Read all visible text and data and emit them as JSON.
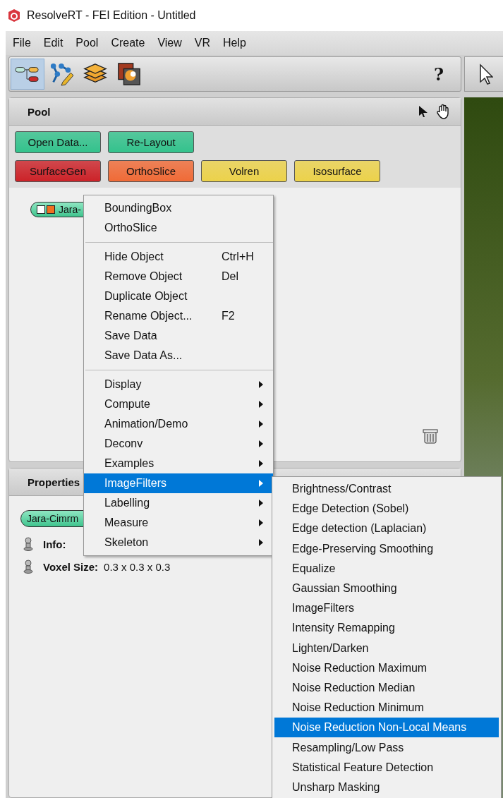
{
  "window": {
    "title": "ResolveRT - FEI Edition - Untitled"
  },
  "menubar": [
    "File",
    "Edit",
    "Pool",
    "Create",
    "View",
    "VR",
    "Help"
  ],
  "toolbar": {
    "tools": [
      {
        "kind": "pool",
        "selected": true
      },
      {
        "kind": "tree",
        "selected": false
      },
      {
        "kind": "layers",
        "selected": false
      },
      {
        "kind": "slices",
        "selected": false
      }
    ],
    "help": "?"
  },
  "pool": {
    "title": "Pool",
    "button_rows": [
      [
        {
          "label": "Open Data...",
          "color": "#33c28c"
        },
        {
          "label": "Re-Layout",
          "color": "#33c28c"
        }
      ],
      [
        {
          "label": "SurfaceGen",
          "color": "#cc2228"
        },
        {
          "label": "OrthoSlice",
          "color": "#f06a36"
        },
        {
          "label": "Volren",
          "color": "#ecd24a"
        },
        {
          "label": "Isosurface",
          "color": "#ecd24a"
        }
      ]
    ],
    "node": {
      "label": "Jara-"
    }
  },
  "properties": {
    "title": "Properties",
    "node": {
      "label": "Jara-Cimrm"
    },
    "fields": [
      {
        "label": "Info:"
      },
      {
        "label": "Voxel Size:",
        "value": "0.3 x 0.3 x 0.3"
      }
    ]
  },
  "context_menu": {
    "sections": [
      [
        {
          "label": "BoundingBox",
          "submenu": false,
          "selected": false
        },
        {
          "label": "OrthoSlice",
          "submenu": false,
          "selected": false
        }
      ],
      [
        {
          "label": "Hide Object",
          "shortcut": "Ctrl+H",
          "submenu": false,
          "selected": false
        },
        {
          "label": "Remove Object",
          "shortcut": "Del",
          "submenu": false,
          "selected": false
        },
        {
          "label": "Duplicate Object",
          "submenu": false,
          "selected": false
        },
        {
          "label": "Rename Object...",
          "shortcut": "F2",
          "submenu": false,
          "selected": false
        },
        {
          "label": "Save Data",
          "submenu": false,
          "selected": false
        },
        {
          "label": "Save Data As...",
          "submenu": false,
          "selected": false
        }
      ],
      [
        {
          "label": "Display",
          "submenu": true,
          "selected": false
        },
        {
          "label": "Compute",
          "submenu": true,
          "selected": false
        },
        {
          "label": "Animation/Demo",
          "submenu": true,
          "selected": false
        },
        {
          "label": "Deconv",
          "submenu": true,
          "selected": false
        },
        {
          "label": "Examples",
          "submenu": true,
          "selected": false
        },
        {
          "label": "ImageFilters",
          "submenu": true,
          "selected": true
        },
        {
          "label": "Labelling",
          "submenu": true,
          "selected": false
        },
        {
          "label": "Measure",
          "submenu": true,
          "selected": false
        },
        {
          "label": "Skeleton",
          "submenu": true,
          "selected": false
        }
      ]
    ]
  },
  "submenu": {
    "items": [
      {
        "label": "Brightness/Contrast",
        "selected": false
      },
      {
        "label": "Edge Detection (Sobel)",
        "selected": false
      },
      {
        "label": "Edge detection (Laplacian)",
        "selected": false
      },
      {
        "label": "Edge-Preserving Smoothing",
        "selected": false
      },
      {
        "label": "Equalize",
        "selected": false
      },
      {
        "label": "Gaussian Smoothing",
        "selected": false
      },
      {
        "label": "ImageFilters",
        "selected": false
      },
      {
        "label": "Intensity Remapping",
        "selected": false
      },
      {
        "label": "Lighten/Darken",
        "selected": false
      },
      {
        "label": "Noise Reduction Maximum",
        "selected": false
      },
      {
        "label": "Noise Reduction Median",
        "selected": false
      },
      {
        "label": "Noise Reduction Minimum",
        "selected": false
      },
      {
        "label": "Noise Reduction Non-Local Means",
        "selected": true
      },
      {
        "label": "Resampling/Low Pass",
        "selected": false
      },
      {
        "label": "Statistical Feature Detection",
        "selected": false
      },
      {
        "label": "Unsharp Masking",
        "selected": false
      }
    ]
  }
}
